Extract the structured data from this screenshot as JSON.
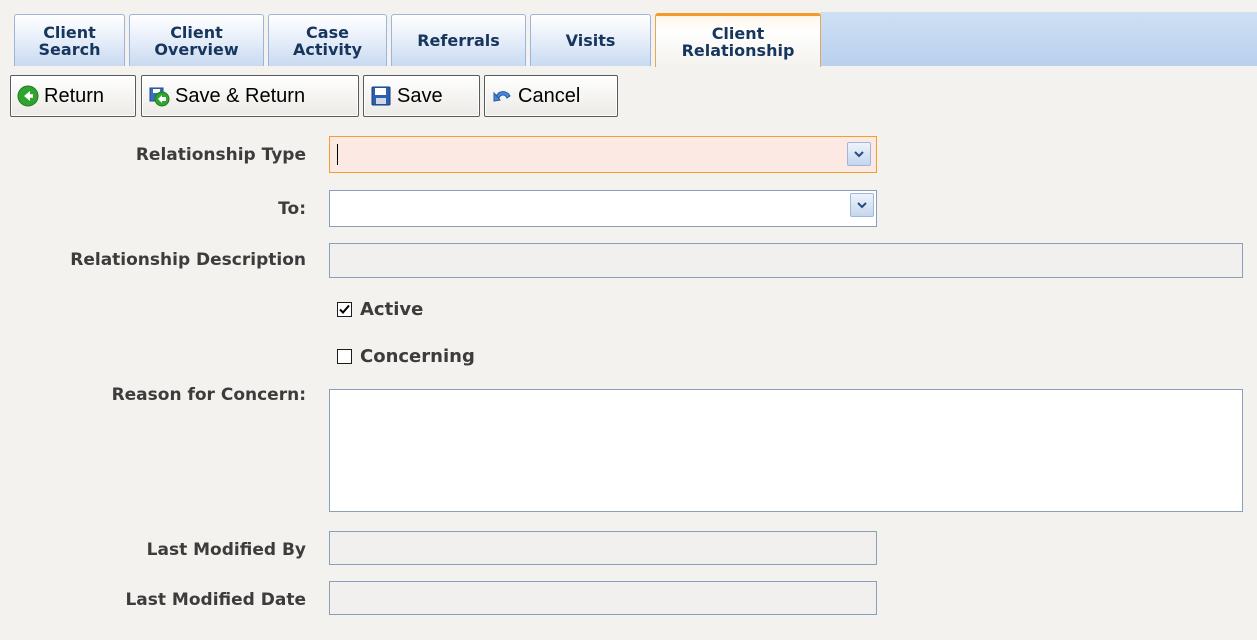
{
  "tabs": [
    {
      "label": "Client\nSearch",
      "active": false
    },
    {
      "label": "Client\nOverview",
      "active": false
    },
    {
      "label": "Case\nActivity",
      "active": false
    },
    {
      "label": "Referrals",
      "active": false
    },
    {
      "label": "Visits",
      "active": false
    },
    {
      "label": "Client\nRelationship",
      "active": true
    }
  ],
  "toolbar": {
    "return_label": "Return",
    "save_return_label": "Save & Return",
    "save_label": "Save",
    "cancel_label": "Cancel",
    "icons": {
      "return": "arrow-left-circle-icon",
      "save_return": "save-and-return-icon",
      "save": "floppy-disk-icon",
      "cancel": "undo-arrow-icon"
    }
  },
  "form": {
    "relationship_type": {
      "label": "Relationship Type",
      "value": ""
    },
    "to": {
      "label": "To:",
      "value": ""
    },
    "relationship_description": {
      "label": "Relationship Description",
      "value": ""
    },
    "active": {
      "label": "Active",
      "checked": true
    },
    "concerning": {
      "label": "Concerning",
      "checked": false
    },
    "reason_for_concern": {
      "label": "Reason for Concern:",
      "value": ""
    },
    "last_modified_by": {
      "label": "Last Modified By",
      "value": ""
    },
    "last_modified_date": {
      "label": "Last Modified Date",
      "value": ""
    }
  },
  "colors": {
    "tab_text": "#17365d",
    "active_tab_accent": "#f39a2c",
    "focus_border": "#f0a030",
    "focus_background": "#fde9e4"
  }
}
